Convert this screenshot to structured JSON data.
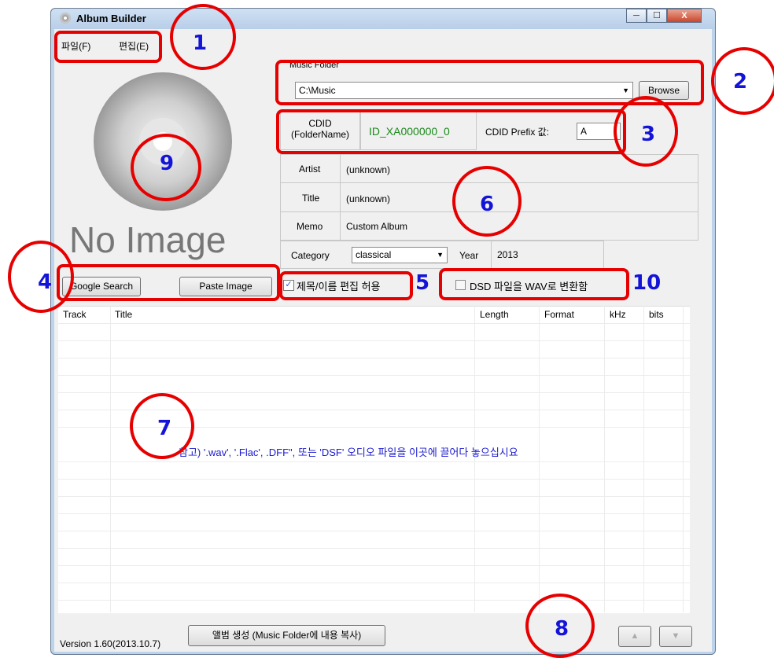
{
  "window": {
    "title": "Album Builder",
    "min_glyph": "─",
    "max_glyph": "☐",
    "close_glyph": "X"
  },
  "menu": {
    "file": "파일(F)",
    "edit": "편집(E)"
  },
  "cover": {
    "no_image_text": "No Image",
    "google_search": "Google Search",
    "paste_image": "Paste Image"
  },
  "music_folder": {
    "label": "Music Folder",
    "value": "C:\\Music",
    "browse": "Browse"
  },
  "cdid": {
    "label_line1": "CDID",
    "label_line2": "(FolderName)",
    "value": "ID_XA000000_0",
    "prefix_label": "CDID Prefix 값:",
    "prefix_value": "A"
  },
  "info": {
    "artist_label": "Artist",
    "artist_value": "(unknown)",
    "title_label": "Title",
    "title_value": "(unknown)",
    "memo_label": "Memo",
    "memo_value": "Custom Album",
    "category_label": "Category",
    "category_value": "classical",
    "year_label": "Year",
    "year_value": "2013"
  },
  "options": {
    "allow_edit": "제목/이름 편집 허용",
    "allow_edit_checked": true,
    "dsd_convert": "DSD 파일을 WAV로 변환함",
    "dsd_checked": false
  },
  "tracklist": {
    "columns": [
      "Track",
      "Title",
      "Length",
      "Format",
      "kHz",
      "bits"
    ],
    "hint": "참고) '.wav', '.Flac', .DFF\", 또는 'DSF' 오디오 파일을 이곳에 끌어다 놓으십시요"
  },
  "footer": {
    "version": "Version 1.60(2013.10.7)",
    "create_album": "앨범 생성 (Music Folder에 내용 복사)",
    "up_glyph": "▲",
    "down_glyph": "▼"
  },
  "callouts": [
    "1",
    "2",
    "3",
    "4",
    "5",
    "6",
    "7",
    "8",
    "9",
    "10"
  ],
  "colors": {
    "callout_red": "#e60000",
    "callout_blue": "#1414d8",
    "cdid_green": "#1a8a1a",
    "hint_blue": "#1a1ad0"
  }
}
